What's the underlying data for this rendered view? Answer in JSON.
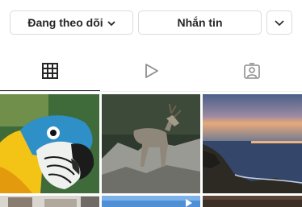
{
  "actions": {
    "following_label": "Đang theo dõi",
    "message_label": "Nhắn tin"
  },
  "icons": {
    "following_dropdown": "chevron-down-icon",
    "more": "chevron-down-icon",
    "tab_posts": "grid-icon",
    "tab_reels": "play-icon",
    "tab_tagged": "tagged-person-icon"
  },
  "tabs": {
    "active": "posts"
  },
  "colors": {
    "text": "#262626",
    "border": "#dbdbdb",
    "inactive_icon": "#8e8e8e"
  },
  "grid": {
    "posts": [
      {
        "subject": "macaw parrot"
      },
      {
        "subject": "deer on rocks"
      },
      {
        "subject": "coastal sunset"
      },
      {
        "subject": "building"
      },
      {
        "subject": "video thumbnail"
      },
      {
        "subject": "dark landscape"
      }
    ]
  }
}
